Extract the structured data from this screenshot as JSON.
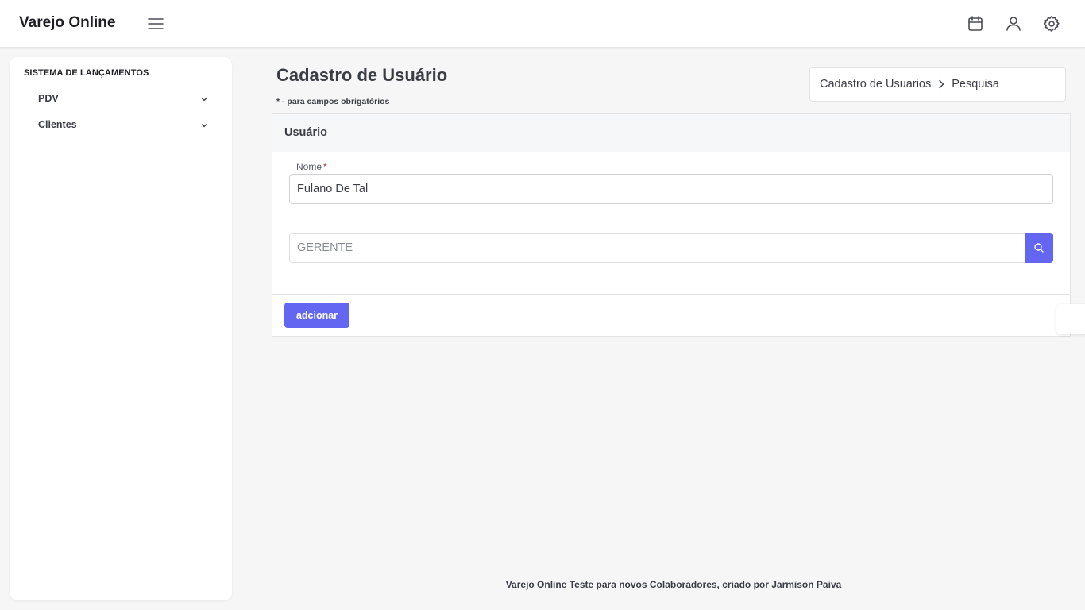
{
  "header": {
    "brand": "Varejo Online",
    "icons": [
      "menu-icon",
      "calendar-icon",
      "user-icon",
      "gear-icon"
    ]
  },
  "sidebar": {
    "heading": "SISTEMA DE LANÇAMENTOS",
    "items": [
      {
        "label": "PDV"
      },
      {
        "label": "Clientes"
      }
    ]
  },
  "page": {
    "title": "Cadastro de Usuário",
    "required_note": "* - para campos obrigatórios"
  },
  "breadcrumb": {
    "items": [
      "Cadastro de Usuarios",
      "Pesquisa"
    ]
  },
  "card": {
    "title": "Usuário",
    "name_field": {
      "label": "Nome",
      "required_mark": "*",
      "value": "Fulano De Tal"
    },
    "role_field": {
      "placeholder": "GERENTE",
      "value": ""
    },
    "add_button": "adcionar"
  },
  "footer": {
    "text": "Varejo Online Teste para novos Colaboradores, criado por Jarmison Paiva"
  },
  "colors": {
    "accent": "#6366f1",
    "required": "#c0292b",
    "background": "#f6f6f6"
  }
}
